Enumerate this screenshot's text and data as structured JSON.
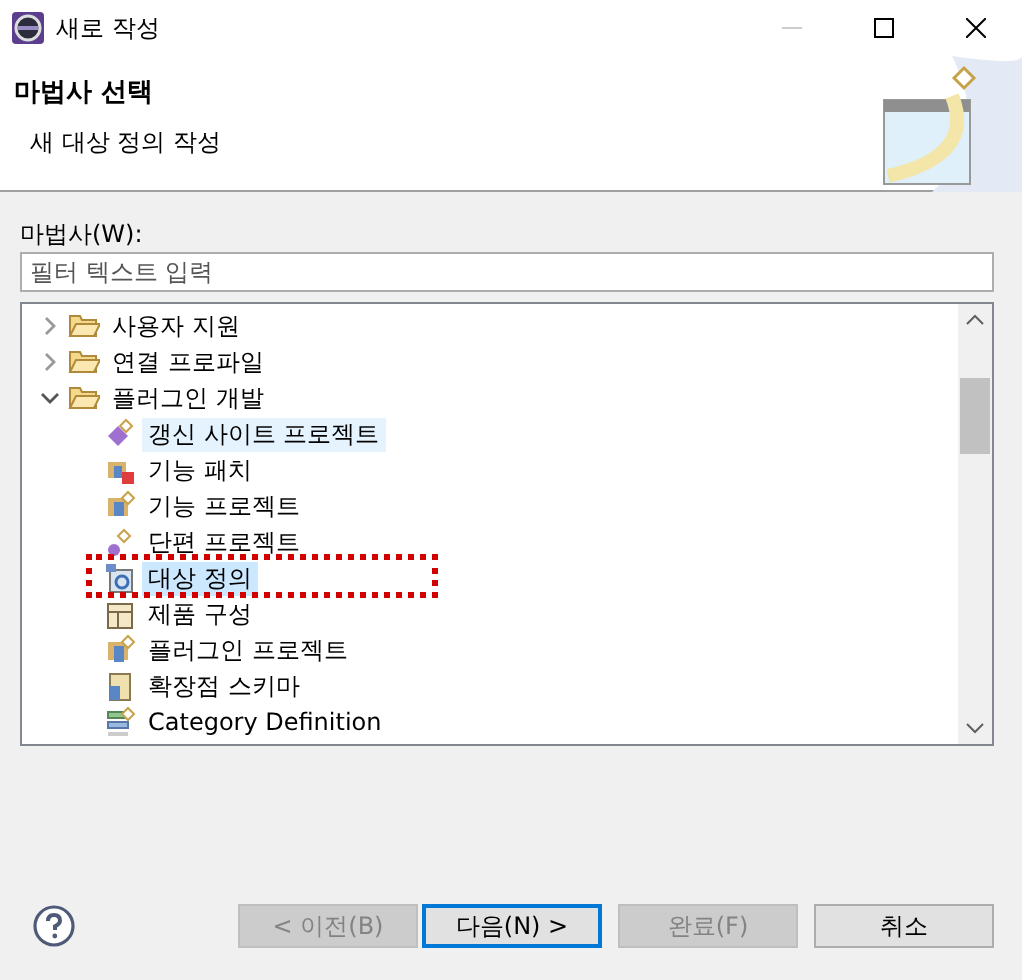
{
  "window": {
    "title": "새로 작성"
  },
  "header": {
    "title": "마법사 선택",
    "description": "새 대상 정의 작성"
  },
  "wizard_label": "마법사(W):",
  "filter": {
    "placeholder": "필터 텍스트 입력"
  },
  "tree": [
    {
      "label": "사용자 지원",
      "expanded": false
    },
    {
      "label": "연결 프로파일",
      "expanded": false
    },
    {
      "label": "플러그인 개발",
      "expanded": true,
      "children": [
        {
          "label": "갱신 사이트 프로젝트",
          "kind": "site",
          "selected": false,
          "hovered": true,
          "annotated": false
        },
        {
          "label": "기능 패치",
          "kind": "patch",
          "selected": false,
          "hovered": false,
          "annotated": false
        },
        {
          "label": "기능 프로젝트",
          "kind": "feature",
          "selected": false,
          "hovered": false,
          "annotated": false
        },
        {
          "label": "단편 프로젝트",
          "kind": "fragment",
          "selected": false,
          "hovered": false,
          "annotated": false
        },
        {
          "label": "대상 정의",
          "kind": "target",
          "selected": true,
          "hovered": false,
          "annotated": true
        },
        {
          "label": "제품 구성",
          "kind": "product",
          "selected": false,
          "hovered": false,
          "annotated": false
        },
        {
          "label": "플러그인 프로젝트",
          "kind": "plugin",
          "selected": false,
          "hovered": false,
          "annotated": false
        },
        {
          "label": "확장점 스키마",
          "kind": "schema",
          "selected": false,
          "hovered": false,
          "annotated": false
        },
        {
          "label": "Category Definition",
          "kind": "category",
          "selected": false,
          "hovered": false,
          "annotated": false
        }
      ]
    }
  ],
  "buttons": [
    {
      "label": "< 이전(B)",
      "disabled": true,
      "default": false
    },
    {
      "label": "다음(N) >",
      "disabled": false,
      "default": true
    },
    {
      "label": "완료(F)",
      "disabled": true,
      "default": false
    },
    {
      "label": "취소",
      "disabled": false,
      "default": false
    }
  ]
}
